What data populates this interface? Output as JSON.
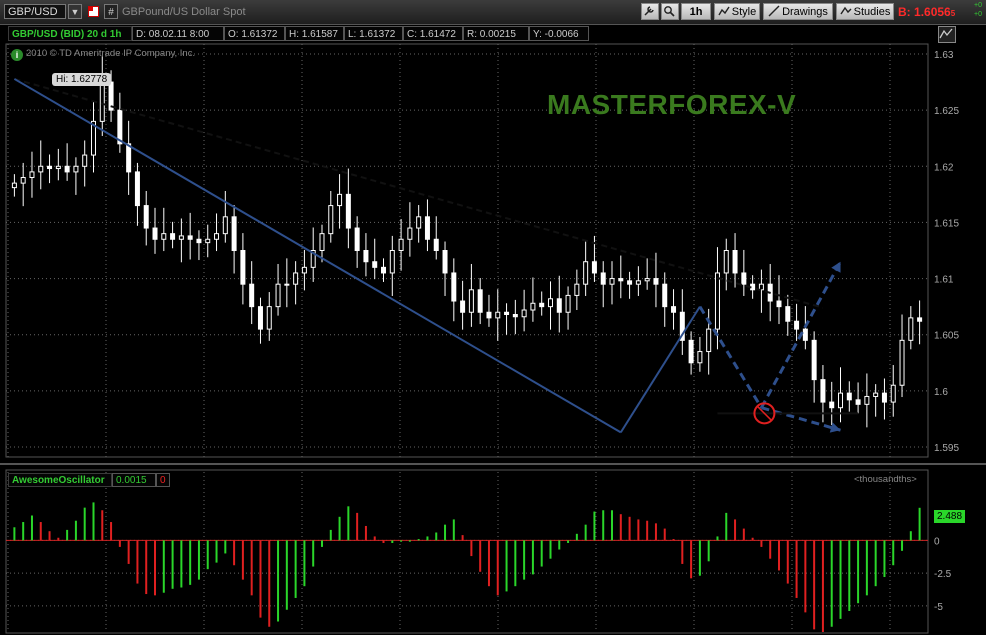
{
  "toolbar": {
    "symbol": "GBP/USD",
    "description": "GBPound/US Dollar Spot",
    "timeframe": "1h",
    "style_label": "Style",
    "drawings_label": "Drawings",
    "studies_label": "Studies",
    "bid_prefix": "B:",
    "bid_value": "1.6056",
    "bid_suffix": "5",
    "change_top": "+0",
    "change_bottom": "+0"
  },
  "infobar": {
    "title": "GBP/USD (BID) 20 d 1h",
    "date": "D: 08.02.11 8:00",
    "open": "O: 1.61372",
    "high": "H: 1.61587",
    "low": "L: 1.61372",
    "close": "C: 1.61472",
    "range": "R: 0.00215",
    "y": "Y: -0.0066"
  },
  "copyright": "2010 © TD Ameritrade IP Company, Inc.",
  "hi_label": "Hi: 1.62778",
  "watermark": "MASTERFOREX-V",
  "oscillator": {
    "name": "AwesomeOscillator",
    "value": "0.0015",
    "zero": "0",
    "units": "<thousandths>",
    "current": "2.488"
  },
  "chart_data": {
    "type": "candlestick",
    "price_axis": {
      "ticks": [
        "1.63",
        "1.625",
        "1.62",
        "1.615",
        "1.61",
        "1.605",
        "1.6",
        "1.595"
      ],
      "ylim": [
        1.595,
        1.63
      ]
    },
    "osc_axis": {
      "ticks": [
        "0",
        "-2.5",
        "-5"
      ],
      "ylim": [
        -7,
        4
      ]
    },
    "annotations": {
      "high": 1.62778,
      "resistance_dashed": [
        [
          0,
          1.62778
        ],
        [
          92,
          1.6074
        ]
      ],
      "channel_line": [
        [
          0,
          1.62778
        ],
        [
          69,
          1.5963
        ]
      ],
      "wave_up": [
        [
          69,
          1.5963
        ],
        [
          78,
          1.6075
        ]
      ],
      "wave_down_dashed": [
        [
          78,
          1.6075
        ],
        [
          85,
          1.5985
        ]
      ],
      "support": 1.598
    },
    "candles_close": [
      1.6185,
      1.619,
      1.6195,
      1.62,
      1.6198,
      1.62,
      1.6195,
      1.62,
      1.621,
      1.624,
      1.6275,
      1.625,
      1.622,
      1.6195,
      1.6165,
      1.6145,
      1.6135,
      1.614,
      1.6135,
      1.6138,
      1.6135,
      1.6132,
      1.6135,
      1.614,
      1.6155,
      1.6125,
      1.6095,
      1.6075,
      1.6055,
      1.6075,
      1.6095,
      1.6095,
      1.6105,
      1.611,
      1.6125,
      1.614,
      1.6165,
      1.6175,
      1.6145,
      1.6125,
      1.6115,
      1.611,
      1.6105,
      1.6125,
      1.6135,
      1.6145,
      1.6155,
      1.6135,
      1.6125,
      1.6105,
      1.608,
      1.607,
      1.609,
      1.607,
      1.6065,
      1.607,
      1.6068,
      1.6066,
      1.6072,
      1.6078,
      1.6075,
      1.6082,
      1.607,
      1.6085,
      1.6095,
      1.6115,
      1.6105,
      1.6095,
      1.61,
      1.6098,
      1.6095,
      1.6098,
      1.61,
      1.6095,
      1.6075,
      1.607,
      1.6045,
      1.6025,
      1.6035,
      1.6055,
      1.6105,
      1.6125,
      1.6105,
      1.6095,
      1.609,
      1.6095,
      1.608,
      1.6075,
      1.6062,
      1.6055,
      1.6045,
      1.601,
      1.599,
      1.5985,
      1.5998,
      1.5992,
      1.5988,
      1.5995,
      1.5998,
      1.599,
      1.6005,
      1.6045,
      1.6065,
      1.6062
    ],
    "ao_values": [
      1.0,
      1.4,
      1.9,
      1.4,
      0.7,
      0.2,
      0.8,
      1.5,
      2.5,
      2.9,
      2.3,
      1.4,
      -0.5,
      -1.8,
      -3.3,
      -4.1,
      -4.2,
      -4.0,
      -3.7,
      -3.6,
      -3.4,
      -3.0,
      -2.2,
      -1.7,
      -1.0,
      -1.9,
      -3.0,
      -4.2,
      -5.9,
      -6.6,
      -6.2,
      -5.3,
      -4.4,
      -3.5,
      -2.0,
      -0.5,
      0.8,
      1.8,
      2.6,
      2.1,
      1.1,
      0.3,
      -0.2,
      -0.2,
      -0.1,
      -0.1,
      0.1,
      0.3,
      0.6,
      1.2,
      1.6,
      0.4,
      -1.2,
      -2.4,
      -3.5,
      -4.2,
      -3.9,
      -3.5,
      -3.0,
      -2.6,
      -2.0,
      -1.4,
      -0.7,
      -0.2,
      0.5,
      1.2,
      2.2,
      2.3,
      2.3,
      2.0,
      1.8,
      1.6,
      1.5,
      1.3,
      0.9,
      0.1,
      -1.8,
      -2.9,
      -2.7,
      -1.6,
      0.3,
      2.1,
      1.6,
      0.9,
      0.2,
      -0.5,
      -1.4,
      -2.3,
      -3.3,
      -4.4,
      -5.5,
      -6.8,
      -7.0,
      -6.6,
      -6.0,
      -5.4,
      -4.8,
      -4.2,
      -3.5,
      -2.8,
      -1.9,
      -0.8,
      0.7,
      2.488
    ]
  }
}
